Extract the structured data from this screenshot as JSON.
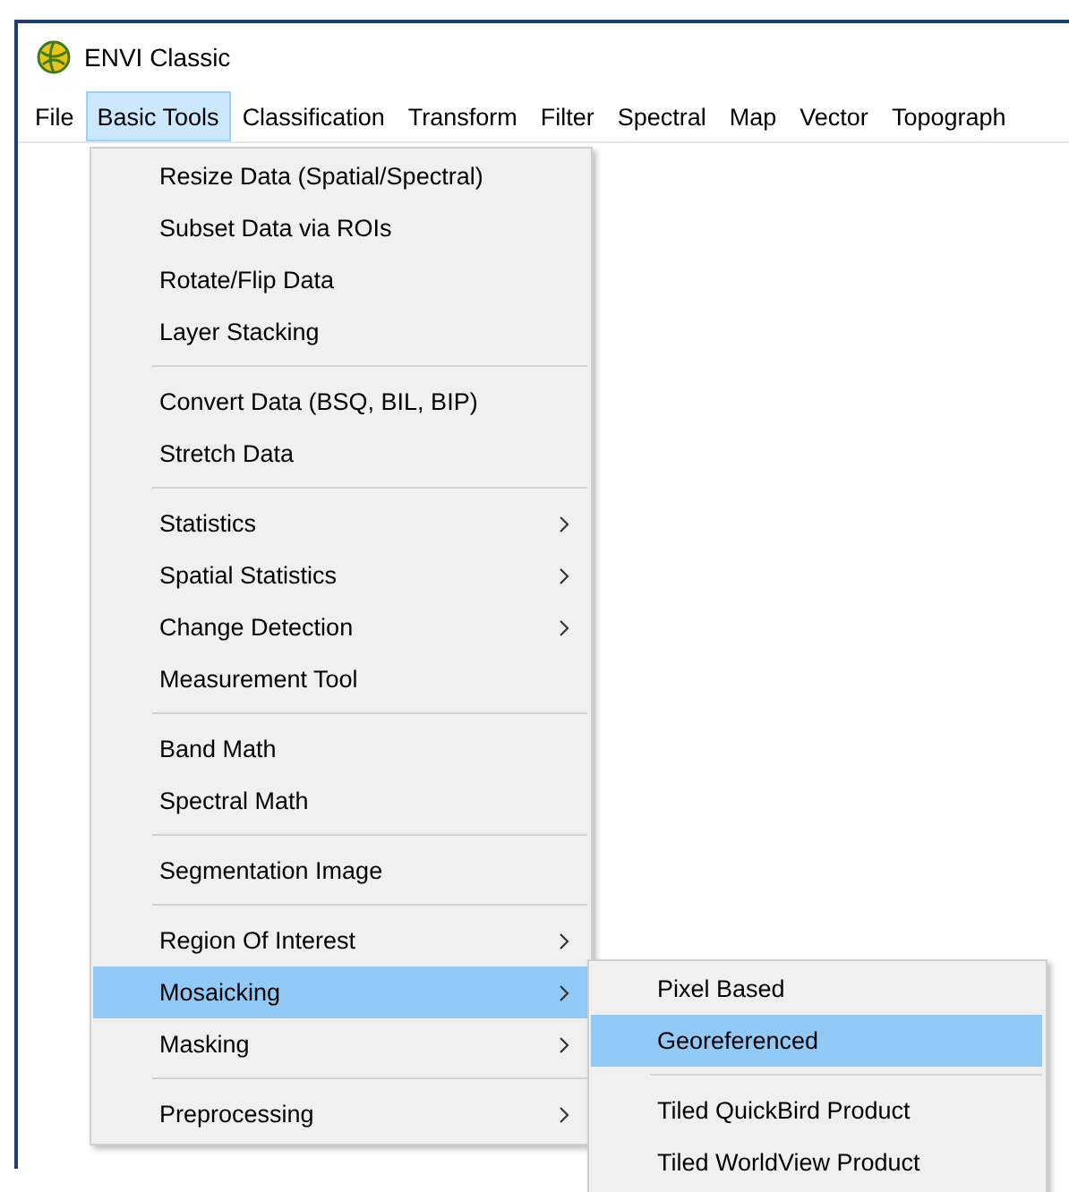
{
  "window": {
    "title": "ENVI Classic"
  },
  "menubar": [
    {
      "label": "File",
      "selected": false
    },
    {
      "label": "Basic Tools",
      "selected": true
    },
    {
      "label": "Classification",
      "selected": false
    },
    {
      "label": "Transform",
      "selected": false
    },
    {
      "label": "Filter",
      "selected": false
    },
    {
      "label": "Spectral",
      "selected": false
    },
    {
      "label": "Map",
      "selected": false
    },
    {
      "label": "Vector",
      "selected": false
    },
    {
      "label": "Topograph",
      "selected": false
    }
  ],
  "menu": {
    "groups": [
      [
        {
          "label": "Resize Data (Spatial/Spectral)",
          "submenu": false,
          "selected": false
        },
        {
          "label": "Subset Data via ROIs",
          "submenu": false,
          "selected": false
        },
        {
          "label": "Rotate/Flip Data",
          "submenu": false,
          "selected": false
        },
        {
          "label": "Layer Stacking",
          "submenu": false,
          "selected": false
        }
      ],
      [
        {
          "label": "Convert Data (BSQ, BIL, BIP)",
          "submenu": false,
          "selected": false
        },
        {
          "label": "Stretch Data",
          "submenu": false,
          "selected": false
        }
      ],
      [
        {
          "label": "Statistics",
          "submenu": true,
          "selected": false
        },
        {
          "label": "Spatial Statistics",
          "submenu": true,
          "selected": false
        },
        {
          "label": "Change Detection",
          "submenu": true,
          "selected": false
        },
        {
          "label": "Measurement Tool",
          "submenu": false,
          "selected": false
        }
      ],
      [
        {
          "label": "Band Math",
          "submenu": false,
          "selected": false
        },
        {
          "label": "Spectral Math",
          "submenu": false,
          "selected": false
        }
      ],
      [
        {
          "label": "Segmentation Image",
          "submenu": false,
          "selected": false
        }
      ],
      [
        {
          "label": "Region Of Interest",
          "submenu": true,
          "selected": false
        },
        {
          "label": "Mosaicking",
          "submenu": true,
          "selected": true
        },
        {
          "label": "Masking",
          "submenu": true,
          "selected": false
        }
      ],
      [
        {
          "label": "Preprocessing",
          "submenu": true,
          "selected": false
        }
      ]
    ]
  },
  "submenu": {
    "groups": [
      [
        {
          "label": "Pixel Based",
          "submenu": false,
          "selected": false
        },
        {
          "label": "Georeferenced",
          "submenu": false,
          "selected": true
        }
      ],
      [
        {
          "label": "Tiled QuickBird Product",
          "submenu": false,
          "selected": false
        },
        {
          "label": "Tiled WorldView Product",
          "submenu": false,
          "selected": false
        }
      ]
    ]
  }
}
